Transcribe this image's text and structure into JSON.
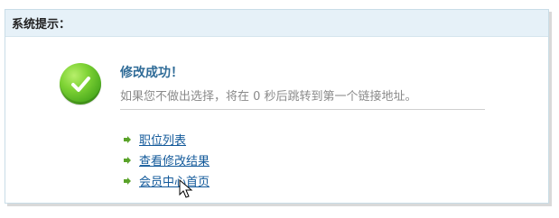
{
  "dialog": {
    "title": "系统提示：",
    "message_title": "修改成功！",
    "message_text": "如果您不做出选择，将在 0 秒后跳转到第一个链接地址。",
    "icon": "check-icon"
  },
  "links": [
    {
      "label": "职位列表",
      "icon": "arrow-icon"
    },
    {
      "label": "查看修改结果",
      "icon": "arrow-icon"
    },
    {
      "label": "会员中心首页",
      "icon": "arrow-icon"
    }
  ],
  "colors": {
    "header_bg": "#e6f1f8",
    "title_blue": "#2f6b97",
    "link_blue": "#12599a",
    "success_green": "#4aa91d",
    "arrow_green": "#5aa32a"
  }
}
